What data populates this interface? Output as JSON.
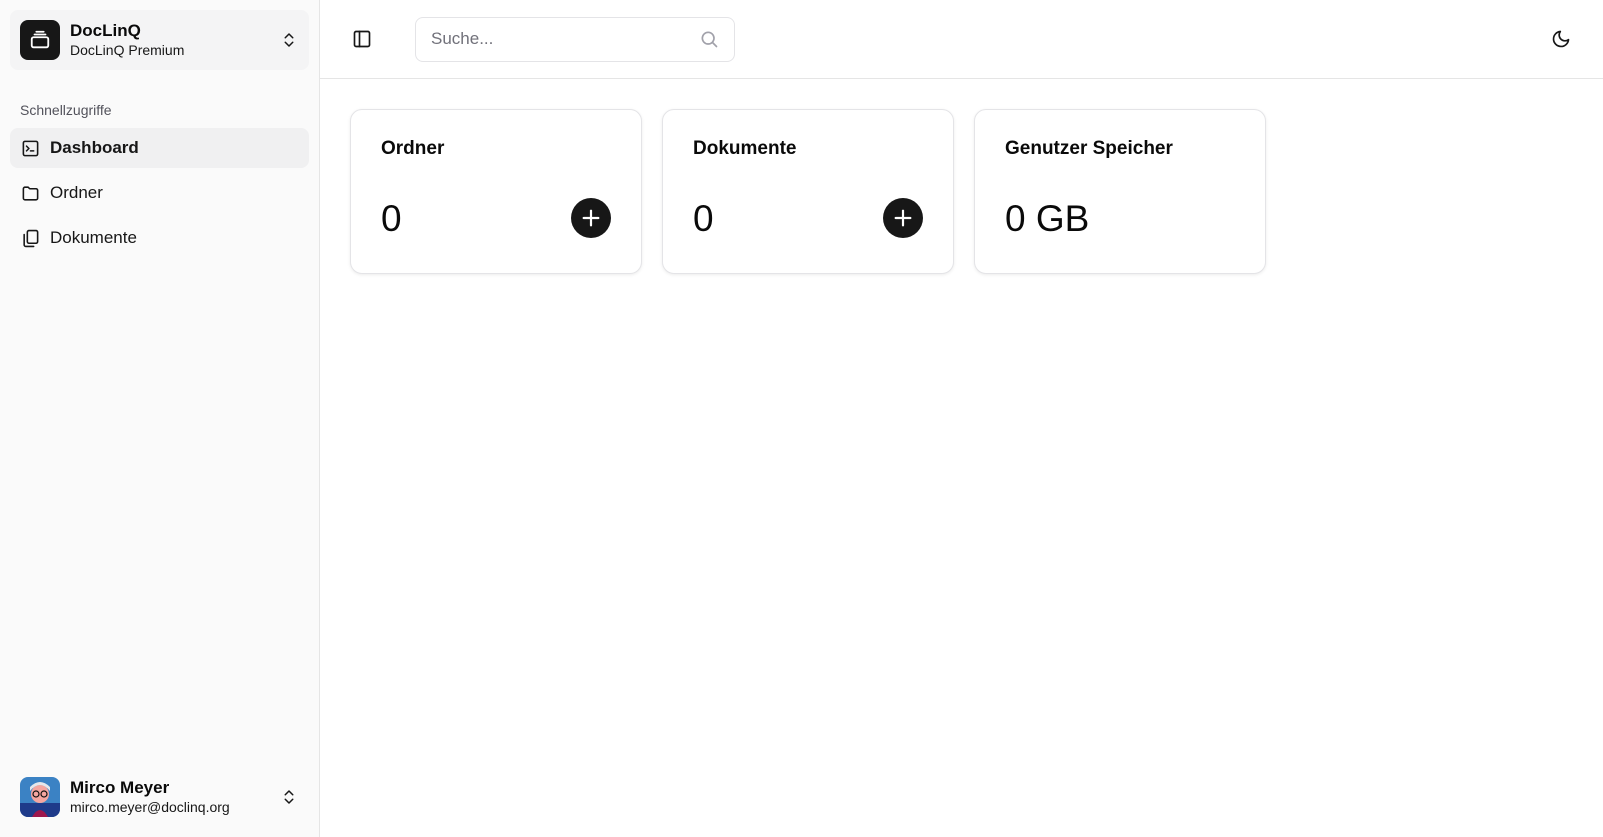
{
  "team": {
    "name": "DocLinQ",
    "plan": "DocLinQ Premium"
  },
  "sidebar": {
    "group_label": "Schnellzugriffe",
    "items": [
      {
        "label": "Dashboard",
        "icon": "terminal-square-icon",
        "active": true
      },
      {
        "label": "Ordner",
        "icon": "folder-icon",
        "active": false
      },
      {
        "label": "Dokumente",
        "icon": "documents-icon",
        "active": false
      }
    ]
  },
  "user": {
    "name": "Mirco Meyer",
    "email": "mirco.meyer@doclinq.org"
  },
  "header": {
    "search_placeholder": "Suche..."
  },
  "cards": [
    {
      "title": "Ordner",
      "value": "0",
      "has_add": true
    },
    {
      "title": "Dokumente",
      "value": "0",
      "has_add": true
    },
    {
      "title": "Genutzer Speicher",
      "value": "0 GB",
      "has_add": false
    }
  ]
}
